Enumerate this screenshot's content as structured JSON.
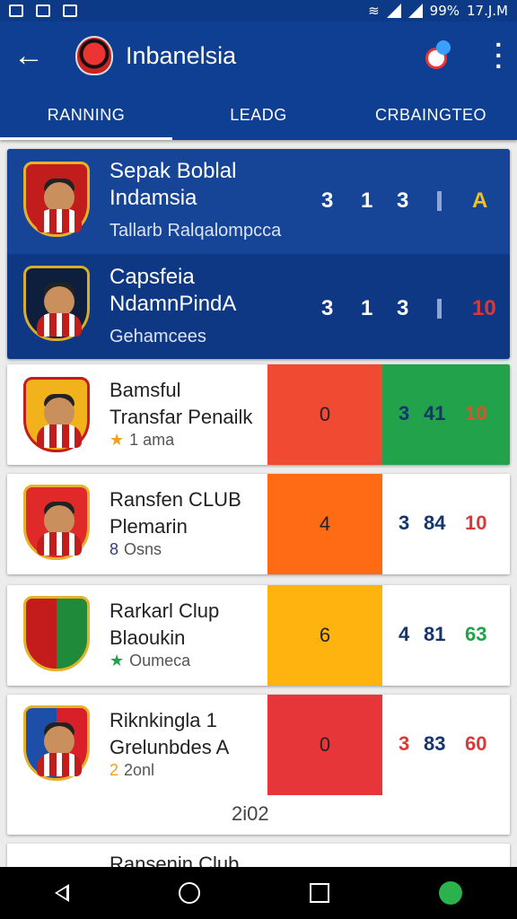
{
  "status": {
    "battery": "99%",
    "time": "17.J.M"
  },
  "appbar": {
    "title": "Inbanelsia"
  },
  "tabs": [
    {
      "label": "RANNING"
    },
    {
      "label": "LEADG"
    },
    {
      "label": "CRBAINGTEO"
    }
  ],
  "header": {
    "rows": [
      {
        "name_line1": "Sepak Boblal",
        "name_line2": "Indamsia",
        "sub": "Tallarb Ralqalompcca",
        "n1": "3",
        "n2": "1",
        "n3": "3",
        "mark": "A"
      },
      {
        "name_line1": "Capsfeia",
        "name_line2": "NdamnPindA",
        "sub": "Gehamcees",
        "n1": "3",
        "n2": "1",
        "n3": "3",
        "mark": "10"
      }
    ]
  },
  "cards": [
    {
      "name_line1": "Bamsful",
      "name_line2": "Transfar Penailk",
      "meta_icon": "★",
      "meta": "1 ama",
      "block": "0",
      "a": "3",
      "b": "41",
      "c": "10"
    },
    {
      "name_line1": "Ransfen CLUB",
      "name_line2": "Plemarin",
      "meta_icon": "8",
      "meta": "Osns",
      "block": "4",
      "a": "3",
      "b": "84",
      "c": "10"
    },
    {
      "name_line1": "Rarkarl Clup",
      "name_line2": "Blaoukin",
      "meta_icon": "★",
      "meta": "Oumeca",
      "block": "6",
      "a": "4",
      "b": "81",
      "c": "63"
    },
    {
      "name_line1": "Riknkingla 1",
      "name_line2": "Grelunbdes A",
      "meta_icon": "2",
      "meta": "2onl",
      "block": "0",
      "a": "3",
      "b": "83",
      "c": "60"
    }
  ],
  "footer_number": "2i02",
  "partial_card": {
    "name": "Ransenin Club"
  },
  "colors": {
    "primary": "#0e3f92",
    "red": "#f04a32",
    "green": "#22a24a",
    "orange": "#ff6a14",
    "amber": "#ffb30f",
    "redblock": "#e6363a"
  }
}
